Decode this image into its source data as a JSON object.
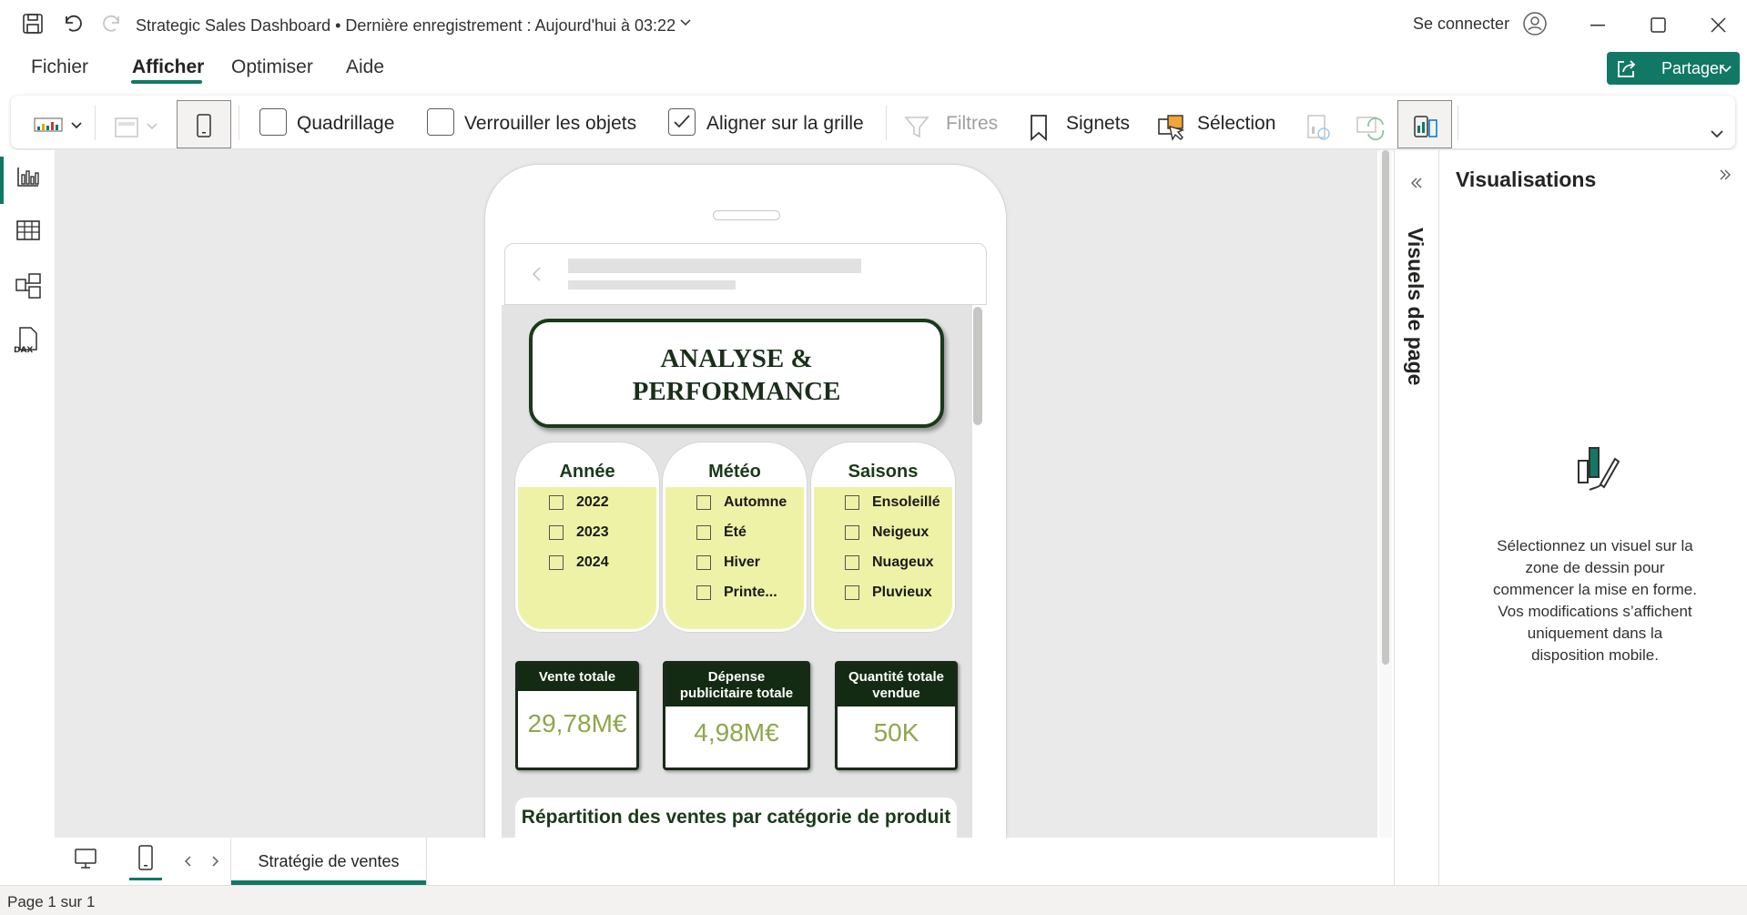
{
  "titlebar": {
    "title": "Strategic Sales Dashboard • Dernière enregistrement : Aujourd'hui à 03:22",
    "signin": "Se connecter"
  },
  "menu": {
    "items": [
      {
        "label": "Fichier"
      },
      {
        "label": "Afficher"
      },
      {
        "label": "Optimiser"
      },
      {
        "label": "Aide"
      }
    ],
    "active": "Afficher",
    "share_label": "Partager"
  },
  "ribbon": {
    "gridlines": "Quadrillage",
    "lock_objects": "Verrouiller les objets",
    "snap_to_grid": "Aligner sur la grille",
    "filters": "Filtres",
    "bookmarks": "Signets",
    "selection": "Sélection",
    "gridlines_checked": false,
    "lock_checked": false,
    "snap_checked": true
  },
  "report": {
    "title_line1": "ANALYSE &",
    "title_line2": "PERFORMANCE",
    "slicers": [
      {
        "title": "Année",
        "options": [
          "2022",
          "2023",
          "2024"
        ]
      },
      {
        "title": "Météo",
        "options": [
          "Automne",
          "Été",
          "Hiver",
          "Printe..."
        ]
      },
      {
        "title": "Saisons",
        "options": [
          "Ensoleillé",
          "Neigeux",
          "Nuageux",
          "Pluvieux"
        ]
      }
    ],
    "kpis": [
      {
        "label": "Vente totale",
        "value": "29,78M€"
      },
      {
        "label": "Dépense publicitaire totale",
        "value": "4,98M€"
      },
      {
        "label": "Quantité totale vendue",
        "value": "50K"
      }
    ],
    "chart_title": "Répartition des ventes par catégorie de produit"
  },
  "tabs": {
    "page_tab": "Stratégie de ventes"
  },
  "status": {
    "page": "Page 1 sur 1"
  },
  "panes": {
    "page_visuals": "Visuels de page",
    "visualizations": "Visualisations",
    "message": "Sélectionnez un visuel sur la zone de dessin pour commencer la mise en forme. Vos modifications s’affichent uniquement dans la disposition mobile."
  },
  "colors": {
    "accent": "#117865",
    "slicer_bg": "#eef2a6",
    "kpi_header": "#132a13",
    "kpi_value": "#8fa64b"
  }
}
